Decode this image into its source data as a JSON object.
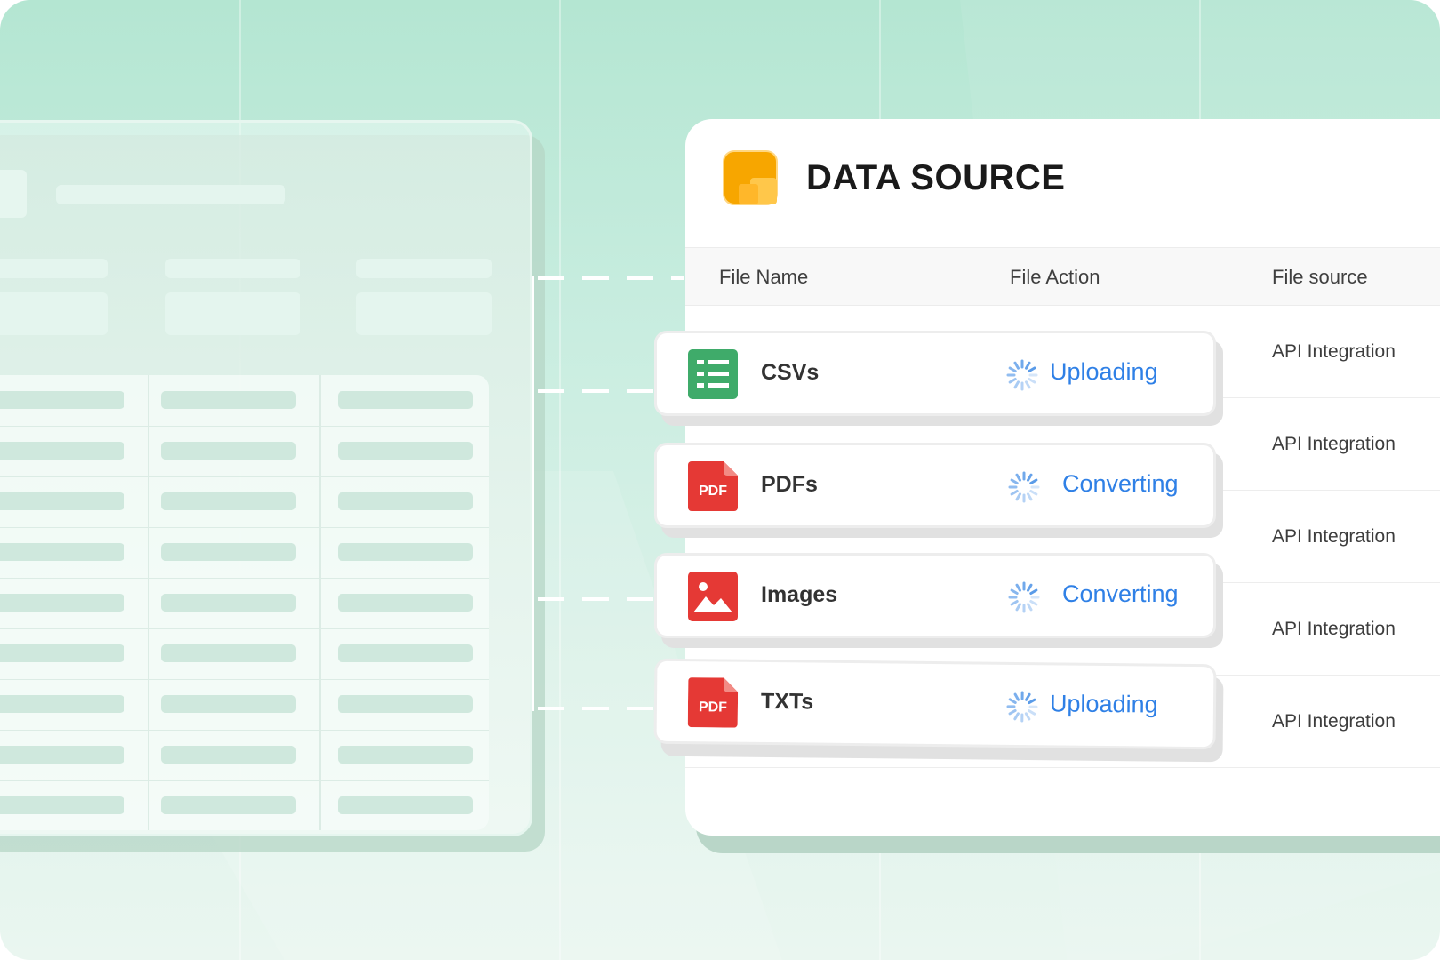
{
  "card": {
    "title": "DATA SOURCE",
    "columns": [
      "File Name",
      "File Action",
      "File source"
    ]
  },
  "files": [
    {
      "name": "CSVs",
      "action": "Uploading",
      "icon": "spreadsheet-icon"
    },
    {
      "name": "PDFs",
      "action": "Converting",
      "icon": "pdf-icon",
      "badge": "PDF"
    },
    {
      "name": "Images",
      "action": "Converting",
      "icon": "image-icon"
    },
    {
      "name": "TXTs",
      "action": "Uploading",
      "icon": "pdf-icon",
      "badge": "PDF"
    }
  ],
  "sources": [
    "API Integration",
    "API Integration",
    "API Integration",
    "API Integration",
    "API Integration"
  ],
  "colors": {
    "accent_blue": "#2f80e6",
    "sheet_green": "#3fab6a",
    "pdf_red": "#e53935",
    "logo_orange": "#f7a600",
    "background_mint": "#b4e6d2"
  }
}
